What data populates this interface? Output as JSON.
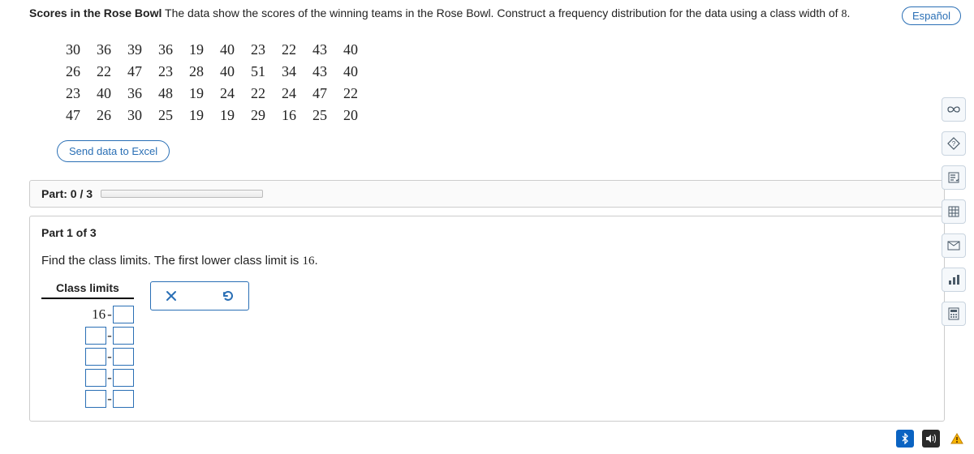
{
  "header": {
    "title": "Scores in the Rose Bowl",
    "text_before_num": " The data show the scores of the winning teams in the Rose Bowl. Construct a frequency distribution for the data using a class width of ",
    "class_width": "8",
    "period": "."
  },
  "lang_button": "Español",
  "data_rows": [
    [
      "30",
      "36",
      "39",
      "36",
      "19",
      "40",
      "23",
      "22",
      "43",
      "40"
    ],
    [
      "26",
      "22",
      "47",
      "23",
      "28",
      "40",
      "51",
      "34",
      "43",
      "40"
    ],
    [
      "23",
      "40",
      "36",
      "48",
      "19",
      "24",
      "22",
      "24",
      "47",
      "22"
    ],
    [
      "47",
      "26",
      "30",
      "25",
      "19",
      "19",
      "29",
      "16",
      "25",
      "20"
    ]
  ],
  "send_button": "Send data to Excel",
  "part_progress": {
    "label": "Part:",
    "current": "0",
    "sep": "/",
    "total": "3"
  },
  "part_body": {
    "label": "Part 1 of 3",
    "instruction_a": "Find the class limits. The first lower class limit is ",
    "first_lower": "16",
    "instruction_b": ".",
    "class_limits_header": "Class limits",
    "first_fixed_lower": "16",
    "dash": "-"
  },
  "side_icons": [
    "oo",
    "help",
    "itemize",
    "table",
    "mail",
    "bar-chart",
    "calc"
  ],
  "tray": {
    "bluetooth": "bt",
    "sound": "snd",
    "alert": "alert"
  }
}
